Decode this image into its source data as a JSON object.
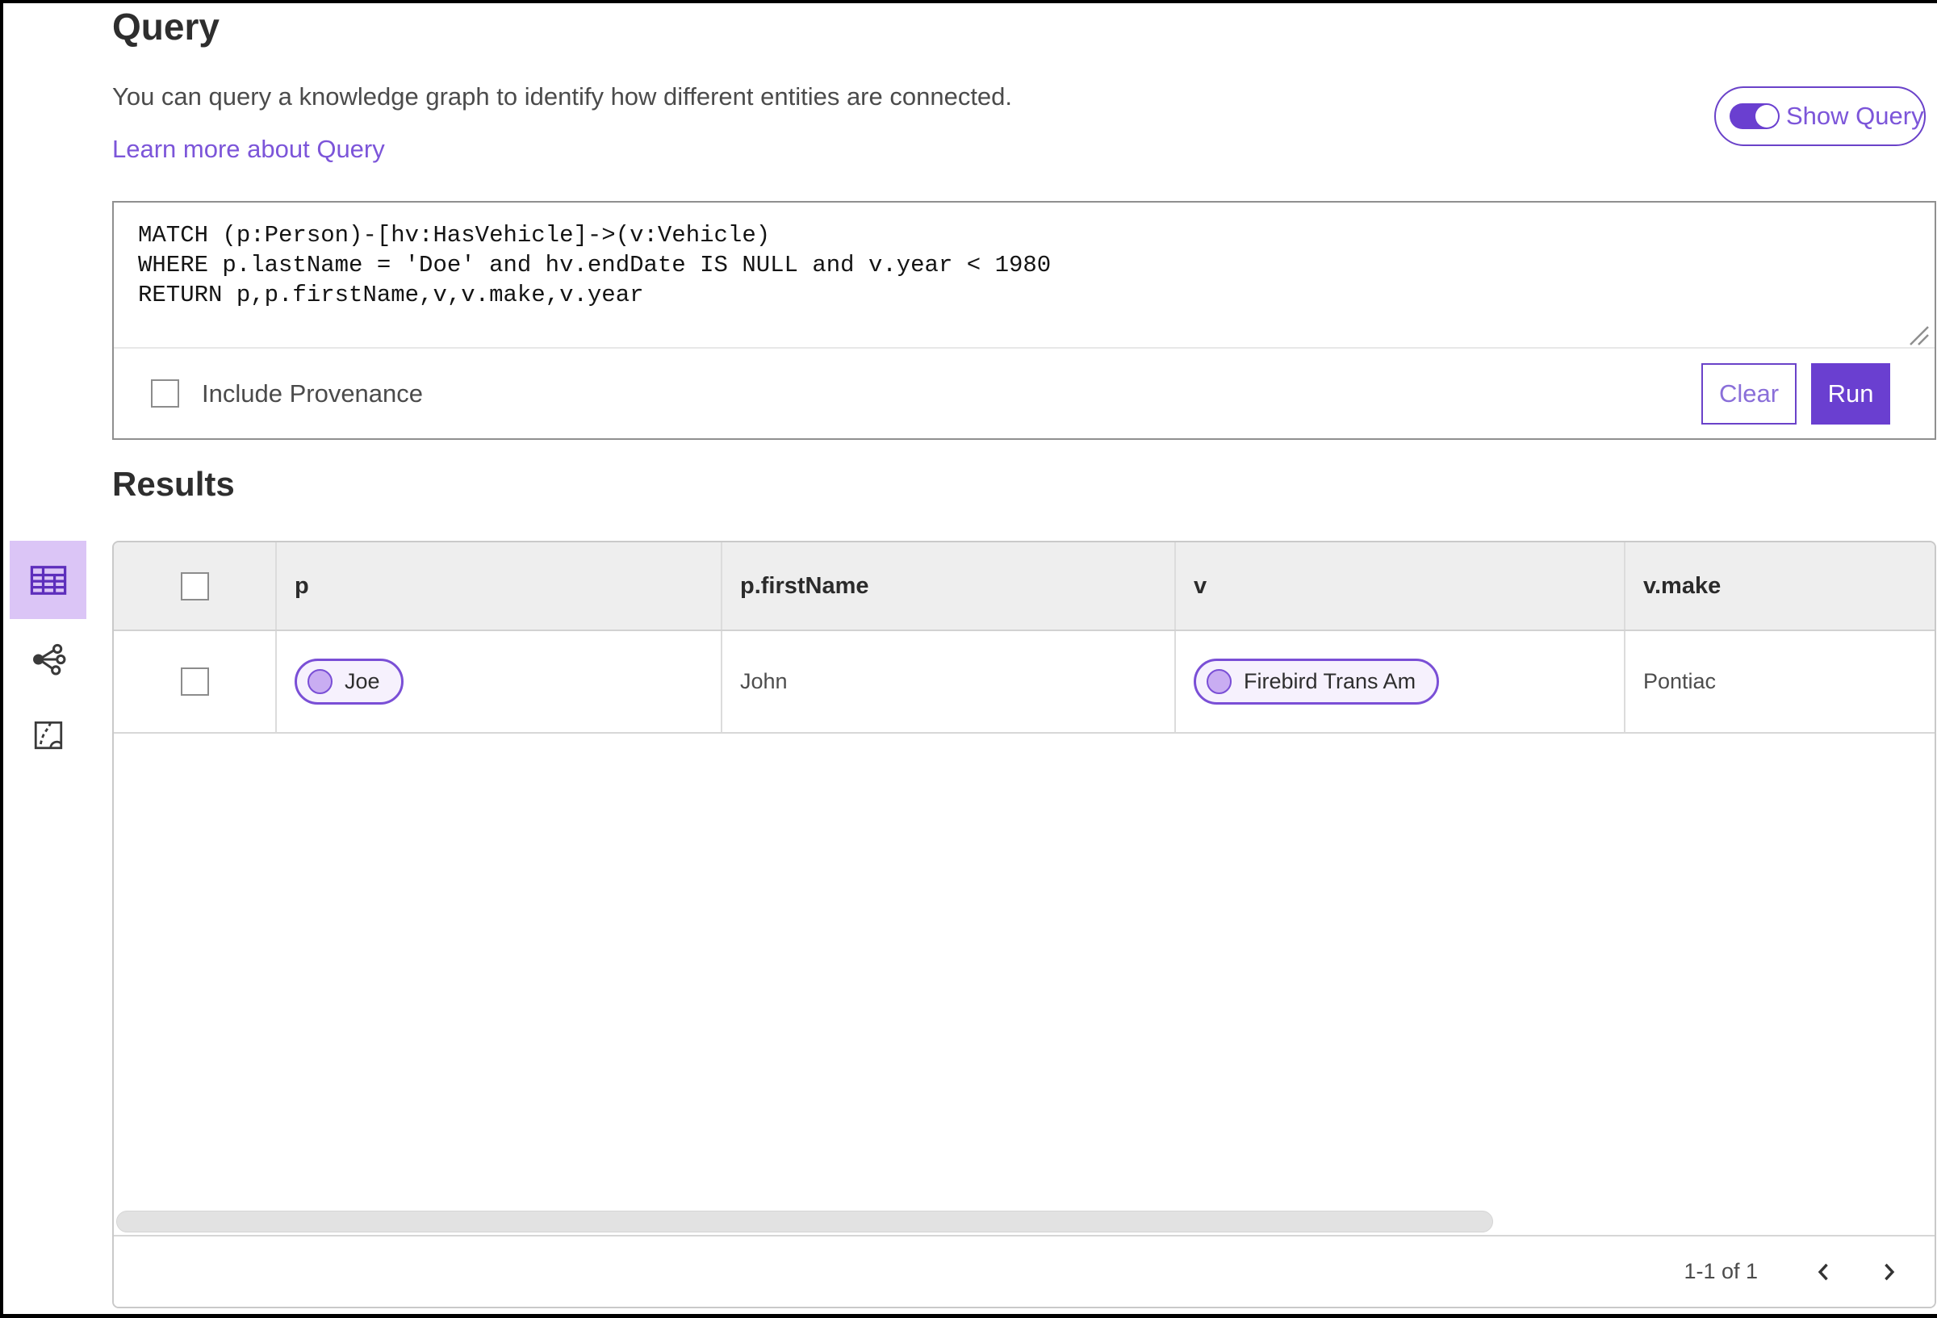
{
  "page": {
    "title": "Query",
    "description": "You can query a knowledge graph to identify how different entities are connected.",
    "learn_more": "Learn more about Query",
    "show_query": {
      "label": "Show Query",
      "state": "on"
    }
  },
  "query_editor": {
    "query_text": "MATCH (p:Person)-[hv:HasVehicle]->(v:Vehicle)\nWHERE p.lastName = 'Doe' and hv.endDate IS NULL and v.year < 1980\nRETURN p,p.firstName,v,v.make,v.year",
    "include_provenance": {
      "label": "Include Provenance",
      "checked": false
    },
    "clear_label": "Clear",
    "run_label": "Run"
  },
  "results": {
    "heading": "Results",
    "view_switcher": [
      {
        "icon": "table-view-icon",
        "selected": true
      },
      {
        "icon": "link-chart-view-icon",
        "selected": false
      },
      {
        "icon": "map-view-icon",
        "selected": false
      }
    ],
    "columns": [
      "p",
      "p.firstName",
      "v",
      "v.make"
    ],
    "rows": [
      {
        "p": "Joe",
        "p_firstName": "John",
        "v": "Firebird Trans Am",
        "v_make": "Pontiac",
        "checked": false
      }
    ],
    "pagination": {
      "range_label": "1-1 of 1"
    }
  },
  "colors": {
    "accent": "#6a3fd0",
    "accent_border": "#6a42c9",
    "accent_text": "#7c55d9",
    "pill_border": "#7a4fd6",
    "pill_background": "#f6f1fd",
    "selected_view_background": "#dbc5f6",
    "table_header_background": "#eeeeee"
  }
}
